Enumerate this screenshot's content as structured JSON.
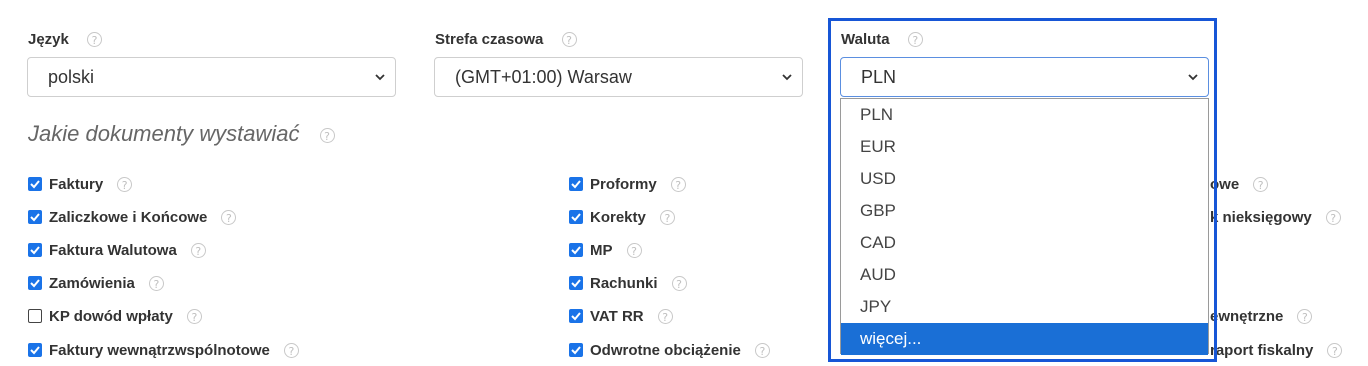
{
  "fields": {
    "language": {
      "label": "Język",
      "value": "polski"
    },
    "timezone": {
      "label": "Strefa czasowa",
      "value": "(GMT+01:00) Warsaw"
    },
    "currency": {
      "label": "Waluta",
      "value": "PLN",
      "options": [
        "PLN",
        "EUR",
        "USD",
        "GBP",
        "CAD",
        "AUD",
        "JPY",
        "więcej..."
      ],
      "highlighted_option": "więcej..."
    }
  },
  "section_title": "Jakie dokumenty wystawiać",
  "help_glyph": "?",
  "documents": {
    "col1": [
      {
        "label": "Faktury",
        "checked": true
      },
      {
        "label": "Zaliczkowe i Końcowe",
        "checked": true
      },
      {
        "label": "Faktura Walutowa",
        "checked": true
      },
      {
        "label": "Zamówienia",
        "checked": true
      },
      {
        "label": "KP dowód wpłaty",
        "checked": false
      },
      {
        "label": "Faktury wewnątrzwspólnotowe",
        "checked": true
      }
    ],
    "col2": [
      {
        "label": "Proformy",
        "checked": true
      },
      {
        "label": "Korekty",
        "checked": true
      },
      {
        "label": "MP",
        "checked": true
      },
      {
        "label": "Rachunki",
        "checked": true
      },
      {
        "label": "VAT RR",
        "checked": true
      },
      {
        "label": "Odwrotne obciążenie",
        "checked": true
      }
    ],
    "col3_partial": [
      "owe",
      "k nieksięgowy",
      "ewnętrzne",
      "raport fiskalny"
    ]
  },
  "colors": {
    "accent": "#1a73e8",
    "highlight_border": "#1756d6",
    "selected_option": "#1a6fd6"
  }
}
